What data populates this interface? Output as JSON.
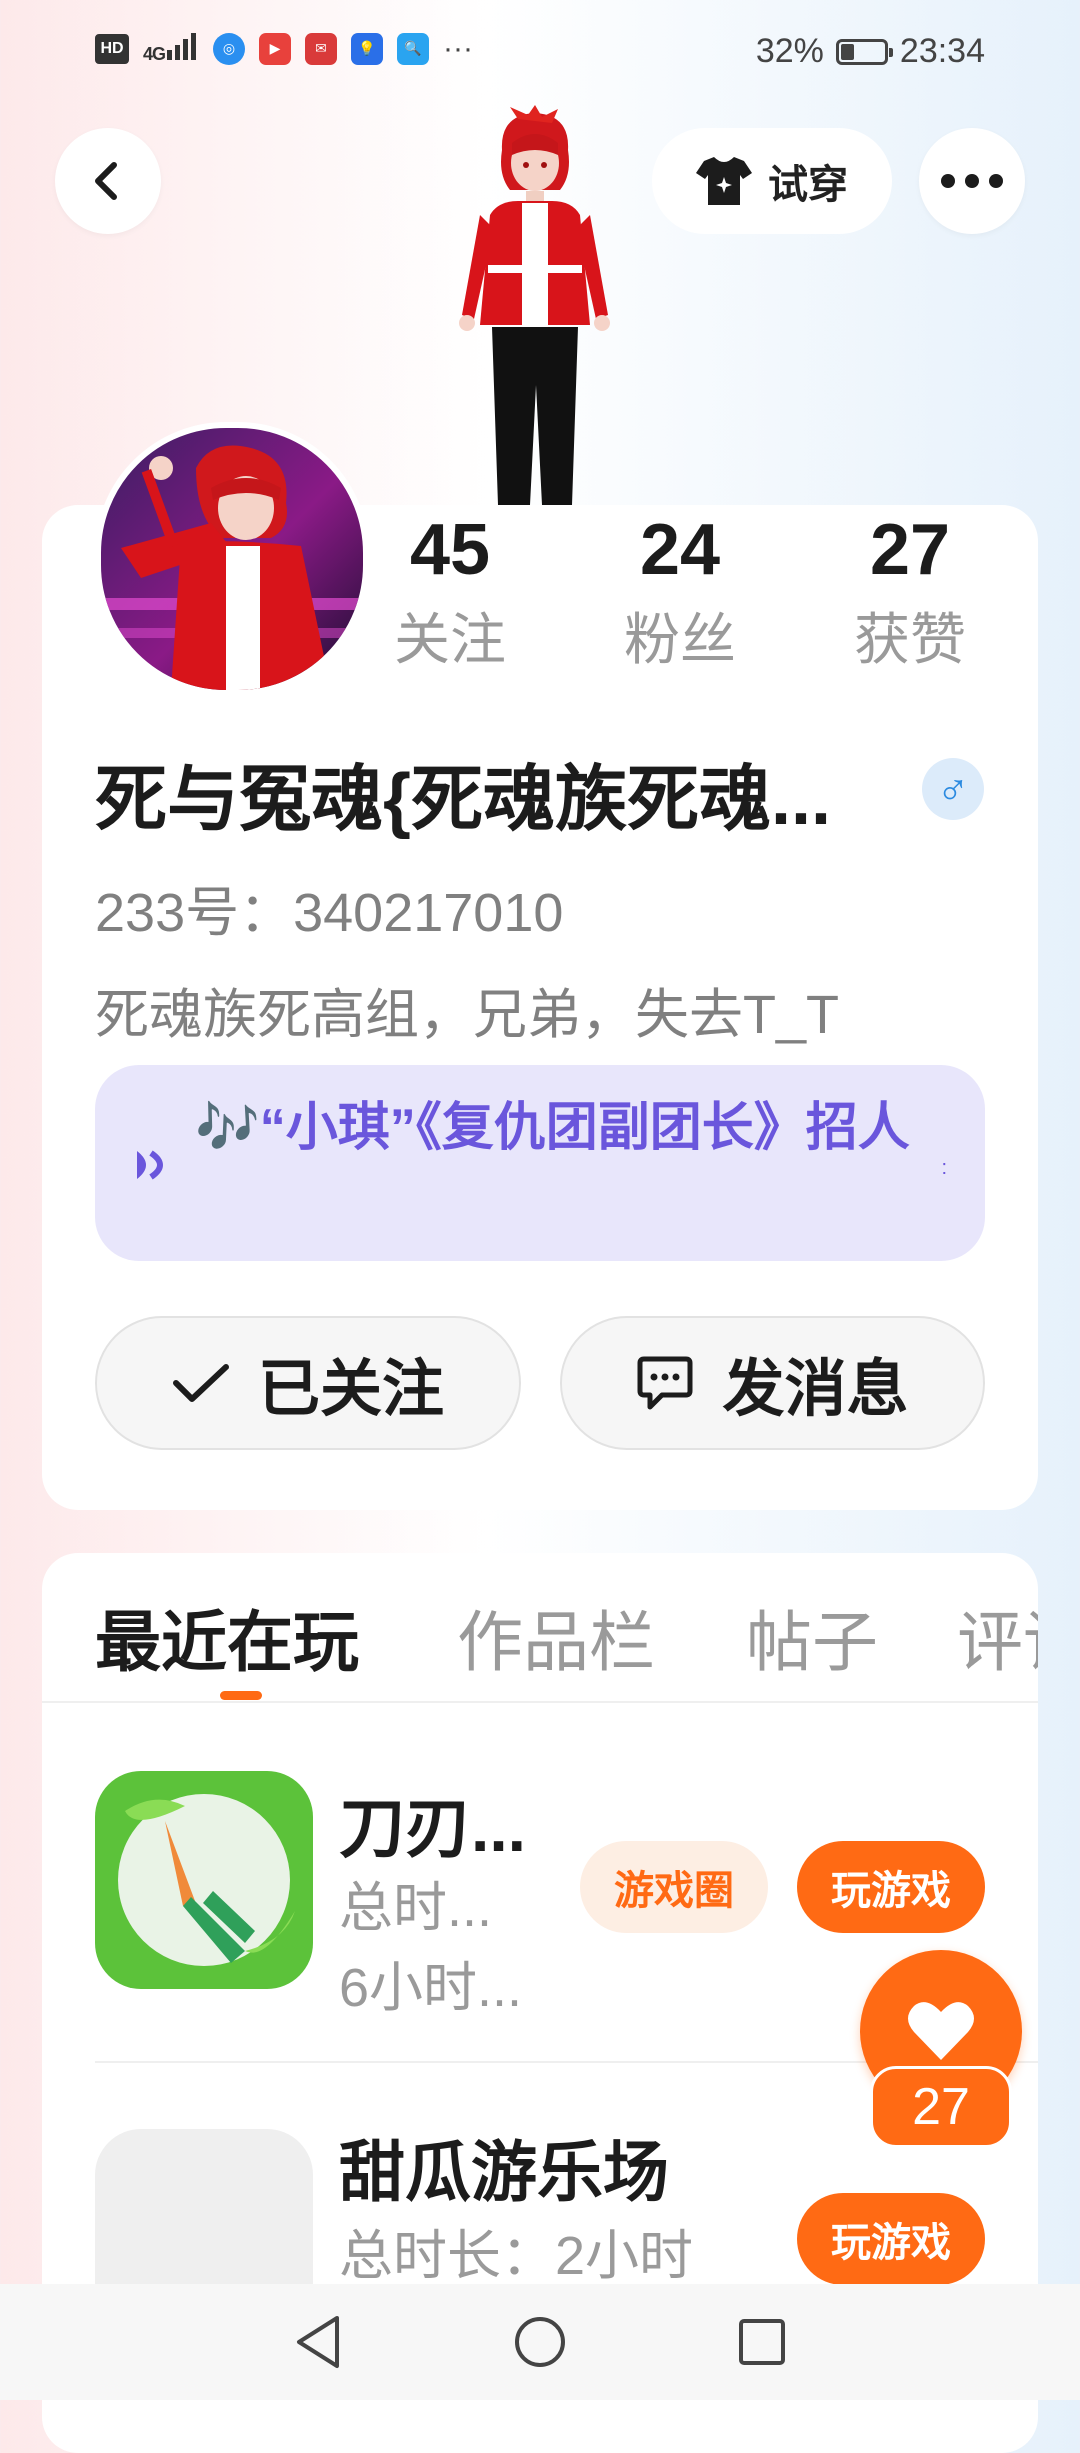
{
  "status_bar": {
    "hd": "HD",
    "network": "4G",
    "battery_percent": "32%",
    "battery_level": 0.32,
    "time": "23:34",
    "more": "···",
    "app_icons": [
      "browser-icon",
      "video-app-icon",
      "huawei-store-icon",
      "tips-icon",
      "search-app-icon"
    ]
  },
  "header": {
    "try_on_label": "试穿"
  },
  "profile": {
    "stats": [
      {
        "value": "45",
        "label": "关注"
      },
      {
        "value": "24",
        "label": "粉丝"
      },
      {
        "value": "27",
        "label": "获赞"
      }
    ],
    "username": "死与冤魂{死魂族死魂...",
    "gender_symbol": "♂",
    "uid": "233号：340217010",
    "bio": "死魂族死高组，兄弟，失去T_T",
    "music_text": "🎶“小琪”《复仇团副团长》招人",
    "follow_label": "已关注",
    "message_label": "发消息"
  },
  "tabs": [
    "最近在玩",
    "作品栏",
    "帖子",
    "评论"
  ],
  "games": [
    {
      "title": "刀刃...",
      "meta1": "总时...",
      "meta2": "6小时...",
      "circle_label": "游戏圈",
      "play_label": "玩游戏"
    },
    {
      "title": "甜瓜游乐场",
      "meta1": "总时长：2小时",
      "play_label": "玩游戏"
    }
  ],
  "like": {
    "count": "27"
  },
  "colors": {
    "accent": "#ff6a14",
    "music_purple": "#6a56dc",
    "gender_blue": "#2b8ae0"
  }
}
